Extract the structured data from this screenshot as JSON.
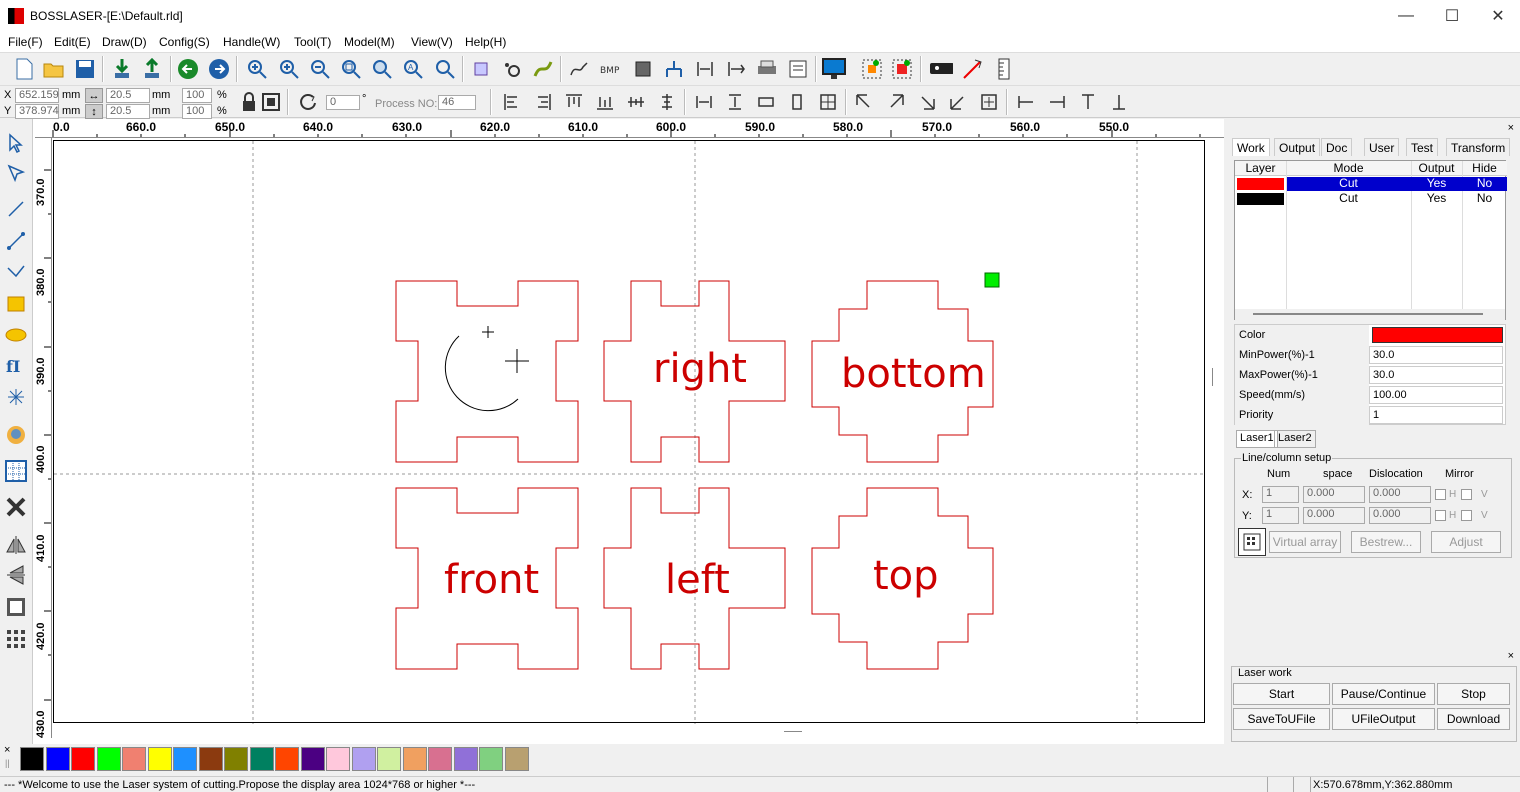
{
  "window": {
    "title": "BOSSLASER-[E:\\Default.rld]",
    "minimize": "—",
    "maximize": "☐",
    "close": "✕"
  },
  "menu": [
    "File(F)",
    "Edit(E)",
    "Draw(D)",
    "Config(S)",
    "Handle(W)",
    "Tool(T)",
    "Model(M)",
    "View(V)",
    "Help(H)"
  ],
  "position": {
    "x_label": "X",
    "y_label": "Y",
    "x_value": "652.159",
    "y_value": "378.974",
    "x_unit": "mm",
    "y_unit": "mm"
  },
  "size": {
    "width": "20.5",
    "height": "20.5",
    "w_unit": "mm",
    "h_unit": "mm"
  },
  "scale": {
    "x": "100",
    "y": "100",
    "x_unit": "%",
    "y_unit": "%"
  },
  "rotate": {
    "value": "0",
    "unit": "°"
  },
  "process": {
    "label": "Process NO:",
    "value": "46"
  },
  "hruler_labels": [
    "0.0",
    "660.0",
    "650.0",
    "640.0",
    "630.0",
    "620.0",
    "610.0",
    "600.0",
    "590.0",
    "580.0",
    "570.0",
    "560.0",
    "550.0"
  ],
  "vruler_labels": [
    "370.0",
    "380.0",
    "390.0",
    "400.0",
    "410.0",
    "420.0",
    "430.0"
  ],
  "design": {
    "labels": [
      "right",
      "bottom",
      "front",
      "left",
      "top"
    ],
    "colors": {
      "cut_red": "#cc0000",
      "moon_black": "#000000",
      "marker_green": "#00ee00",
      "guide": "#999999"
    }
  },
  "tabs": [
    "Work",
    "Output",
    "Doc",
    "User",
    "Test",
    "Transform"
  ],
  "layer_table": {
    "headers": [
      "Layer",
      "Mode",
      "Output",
      "Hide"
    ],
    "rows": [
      {
        "color": "#ff0000",
        "mode": "Cut",
        "output": "Yes",
        "hide": "No",
        "selected": true
      },
      {
        "color": "#000000",
        "mode": "Cut",
        "output": "Yes",
        "hide": "No",
        "selected": false
      }
    ]
  },
  "properties": [
    {
      "label": "Color",
      "value": ""
    },
    {
      "label": "MinPower(%)-1",
      "value": "30.0"
    },
    {
      "label": "MaxPower(%)-1",
      "value": "30.0"
    },
    {
      "label": "Speed(mm/s)",
      "value": "100.00"
    },
    {
      "label": "Priority",
      "value": "1"
    }
  ],
  "property_color": "#ff0000",
  "laser_tabs": [
    "Laser1",
    "Laser2"
  ],
  "array_setup": {
    "title": "Line/column setup",
    "headers": [
      "Num",
      "space",
      "Dislocation",
      "Mirror"
    ],
    "x_label": "X:",
    "y_label": "Y:",
    "x": {
      "num": "1",
      "space": "0.000",
      "dislocation": "0.000"
    },
    "y": {
      "num": "1",
      "space": "0.000",
      "dislocation": "0.000"
    },
    "mirror_h": "H",
    "mirror_v": "V",
    "buttons": [
      "Virtual array",
      "Bestrew...",
      "Adjust"
    ]
  },
  "laser_work": {
    "title": "Laser work",
    "buttons": [
      "Start",
      "Pause/Continue",
      "Stop",
      "SaveToUFile",
      "UFileOutput",
      "Download"
    ]
  },
  "palette": [
    "#000000",
    "#0000ff",
    "#ff0000",
    "#00ff00",
    "#f08070",
    "#ffff00",
    "#1e90ff",
    "#8b3a0f",
    "#808000",
    "#008060",
    "#ff4500",
    "#4b0082",
    "#ffc8dc",
    "#b0a0f0",
    "#d0f0a0",
    "#f0a060",
    "#d87090",
    "#9070d8",
    "#80d080",
    "#b8a070"
  ],
  "status": {
    "message": "--- *Welcome to use the Laser system of cutting.Propose the display area 1024*768 or higher *---",
    "coords": "X:570.678mm,Y:362.880mm"
  }
}
